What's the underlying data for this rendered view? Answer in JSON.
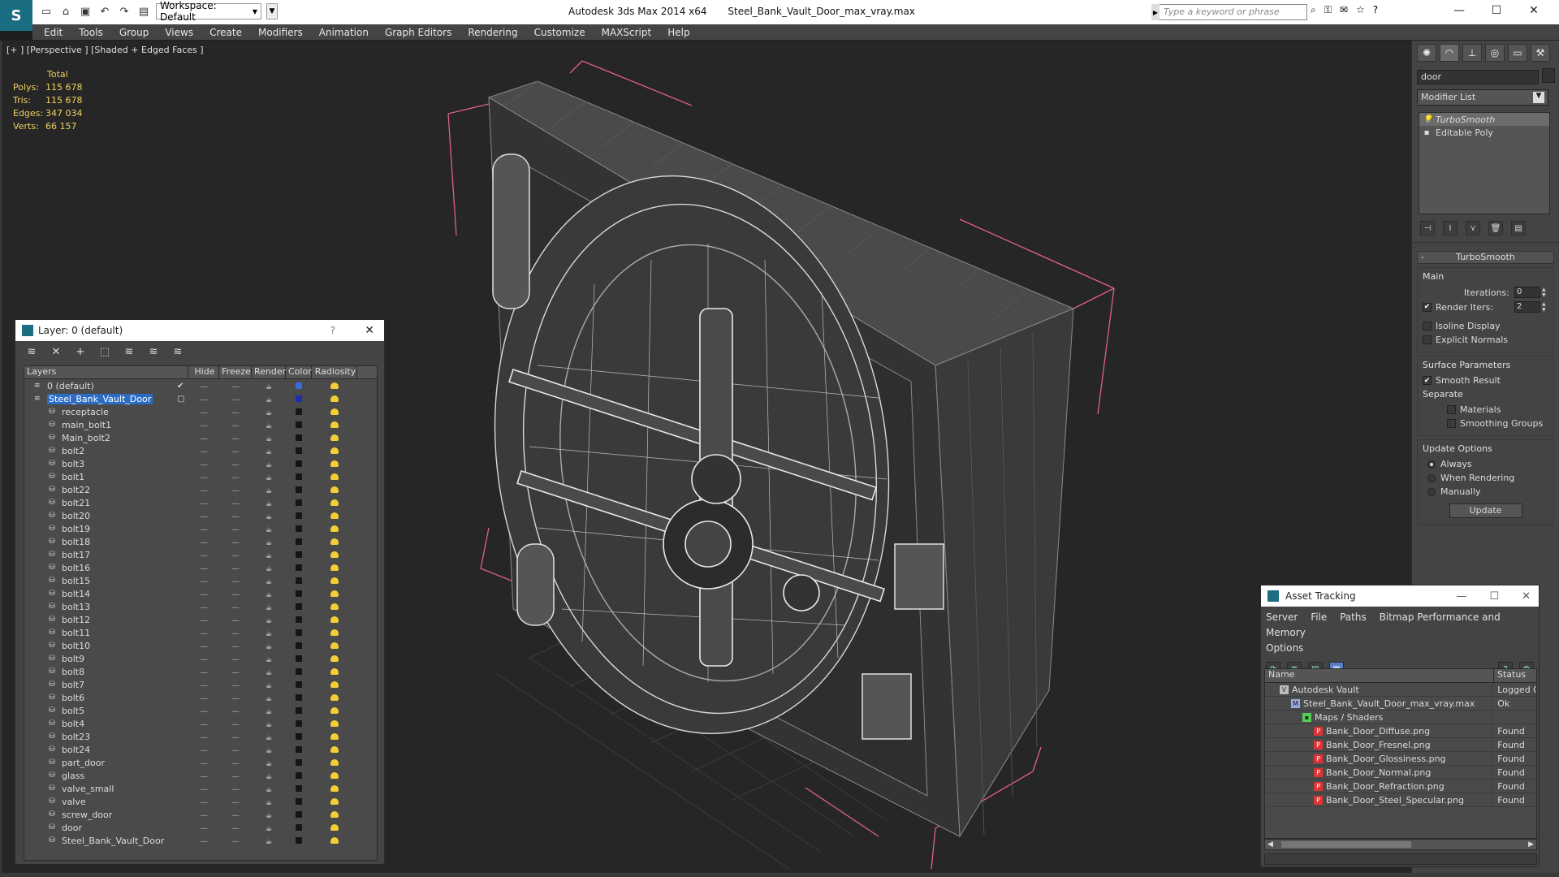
{
  "titlebar": {
    "workspace": "Workspace: Default",
    "app_name": "Autodesk 3ds Max  2014 x64",
    "file_name": "Steel_Bank_Vault_Door_max_vray.max",
    "search_placeholder": "Type a keyword or phrase"
  },
  "menu": [
    "Edit",
    "Tools",
    "Group",
    "Views",
    "Create",
    "Modifiers",
    "Animation",
    "Graph Editors",
    "Rendering",
    "Customize",
    "MAXScript",
    "Help"
  ],
  "viewport": {
    "label": "[+ ] [Perspective ] [Shaded + Edged Faces ]",
    "stats_header": "Total",
    "stats": [
      {
        "k": "Polys:",
        "v": "115 678"
      },
      {
        "k": "Tris:",
        "v": "115 678"
      },
      {
        "k": "Edges:",
        "v": "347 034"
      },
      {
        "k": "Verts:",
        "v": "66 157"
      }
    ]
  },
  "command_panel": {
    "object_name": "door",
    "modifier_list": "Modifier List",
    "stack": [
      {
        "label": "TurboSmooth",
        "selected": true
      },
      {
        "label": "Editable Poly",
        "selected": false
      }
    ],
    "rollout": "TurboSmooth",
    "main_group": "Main",
    "iterations_label": "Iterations:",
    "iterations_value": "0",
    "render_iters_label": "Render Iters:",
    "render_iters_value": "2",
    "isoline": "Isoline Display",
    "explicit_normals": "Explicit Normals",
    "surface_group": "Surface Parameters",
    "smooth_result": "Smooth Result",
    "separate": "Separate",
    "materials": "Materials",
    "smoothing_groups": "Smoothing Groups",
    "update_group": "Update Options",
    "always": "Always",
    "when_rendering": "When Rendering",
    "manually": "Manually",
    "update_btn": "Update"
  },
  "layer_dialog": {
    "title": "Layer: 0 (default)",
    "help": "?",
    "columns": [
      "Layers",
      "Hide",
      "Freeze",
      "Render",
      "Color",
      "Radiosity"
    ],
    "rows": [
      {
        "name": "0 (default)",
        "level": 0,
        "type": "layer",
        "color": "blue",
        "current": true
      },
      {
        "name": "Steel_Bank_Vault_Door",
        "level": 0,
        "type": "layer",
        "color": "dblue",
        "selected": true
      },
      {
        "name": "receptacle",
        "level": 1
      },
      {
        "name": "main_bolt1",
        "level": 1
      },
      {
        "name": "Main_bolt2",
        "level": 1
      },
      {
        "name": "bolt2",
        "level": 1
      },
      {
        "name": "bolt3",
        "level": 1
      },
      {
        "name": "bolt1",
        "level": 1
      },
      {
        "name": "bolt22",
        "level": 1
      },
      {
        "name": "bolt21",
        "level": 1
      },
      {
        "name": "bolt20",
        "level": 1
      },
      {
        "name": "bolt19",
        "level": 1
      },
      {
        "name": "bolt18",
        "level": 1
      },
      {
        "name": "bolt17",
        "level": 1
      },
      {
        "name": "bolt16",
        "level": 1
      },
      {
        "name": "bolt15",
        "level": 1
      },
      {
        "name": "bolt14",
        "level": 1
      },
      {
        "name": "bolt13",
        "level": 1
      },
      {
        "name": "bolt12",
        "level": 1
      },
      {
        "name": "bolt11",
        "level": 1
      },
      {
        "name": "bolt10",
        "level": 1
      },
      {
        "name": "bolt9",
        "level": 1
      },
      {
        "name": "bolt8",
        "level": 1
      },
      {
        "name": "bolt7",
        "level": 1
      },
      {
        "name": "bolt6",
        "level": 1
      },
      {
        "name": "bolt5",
        "level": 1
      },
      {
        "name": "bolt4",
        "level": 1
      },
      {
        "name": "bolt23",
        "level": 1
      },
      {
        "name": "bolt24",
        "level": 1
      },
      {
        "name": "part_door",
        "level": 1
      },
      {
        "name": "glass",
        "level": 1
      },
      {
        "name": "valve_small",
        "level": 1
      },
      {
        "name": "valve",
        "level": 1
      },
      {
        "name": "screw_door",
        "level": 1
      },
      {
        "name": "door",
        "level": 1
      },
      {
        "name": "Steel_Bank_Vault_Door",
        "level": 1
      }
    ]
  },
  "asset_dialog": {
    "title": "Asset Tracking",
    "menu": [
      "Server",
      "File",
      "Paths",
      "Bitmap Performance and Memory",
      "Options"
    ],
    "columns": [
      "Name",
      "Status"
    ],
    "rows": [
      {
        "name": "Autodesk Vault",
        "status": "Logged Out",
        "level": 0,
        "icon": "vault"
      },
      {
        "name": "Steel_Bank_Vault_Door_max_vray.max",
        "status": "Ok",
        "level": 1,
        "icon": "max"
      },
      {
        "name": "Maps / Shaders",
        "status": "",
        "level": 2,
        "icon": "folder"
      },
      {
        "name": "Bank_Door_Diffuse.png",
        "status": "Found",
        "level": 3,
        "icon": "png"
      },
      {
        "name": "Bank_Door_Fresnel.png",
        "status": "Found",
        "level": 3,
        "icon": "png"
      },
      {
        "name": "Bank_Door_Glossiness.png",
        "status": "Found",
        "level": 3,
        "icon": "png"
      },
      {
        "name": "Bank_Door_Normal.png",
        "status": "Found",
        "level": 3,
        "icon": "png"
      },
      {
        "name": "Bank_Door_Refraction.png",
        "status": "Found",
        "level": 3,
        "icon": "png"
      },
      {
        "name": "Bank_Door_Steel_Specular.png",
        "status": "Found",
        "level": 3,
        "icon": "png"
      }
    ]
  }
}
